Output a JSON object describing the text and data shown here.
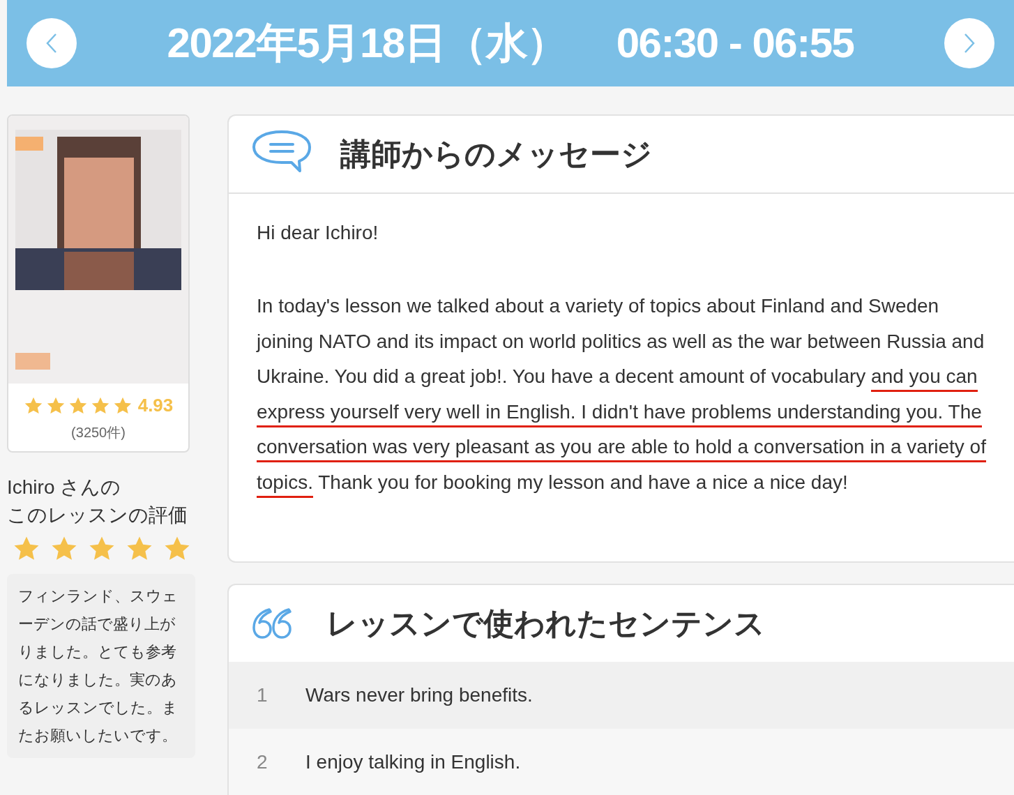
{
  "header": {
    "date": "2022年5月18日（水）",
    "time": "06:30 - 06:55"
  },
  "tutor": {
    "rating": {
      "stars": 4.93,
      "value": "4.93",
      "count": "(3250件)"
    }
  },
  "review": {
    "title_lines": [
      "Ichiro さんの",
      "このレッスンの評価"
    ],
    "stars": 5,
    "comment": "フィンランド、スウェーデンの話で盛り上がりました。とても参考になりました。実のあるレッスンでした。またお願いしたいです。"
  },
  "message": {
    "title": "講師からのメッセージ",
    "greeting": "Hi dear Ichiro!",
    "segments": [
      {
        "text": "In today's lesson we talked about a variety of topics about Finland and Sweden joining NATO and its impact on world politics as well as the war between Russia and Ukraine. You did a great job!. You have a decent amount of vocabulary ",
        "underlined": false
      },
      {
        "text": "and you can express yourself very well in English. I didn't have problems understanding you. The conversation was very pleasant as you are able to hold a conversation in a variety of topics.",
        "underlined": true
      },
      {
        "text": " Thank you for booking my lesson and have a nice a nice day!",
        "underlined": false
      }
    ]
  },
  "sentences": {
    "title": "レッスンで使われたセンテンス",
    "rows": [
      {
        "number": "1",
        "text": "Wars never bring benefits."
      },
      {
        "number": "2",
        "text": "I enjoy talking in English."
      }
    ]
  }
}
